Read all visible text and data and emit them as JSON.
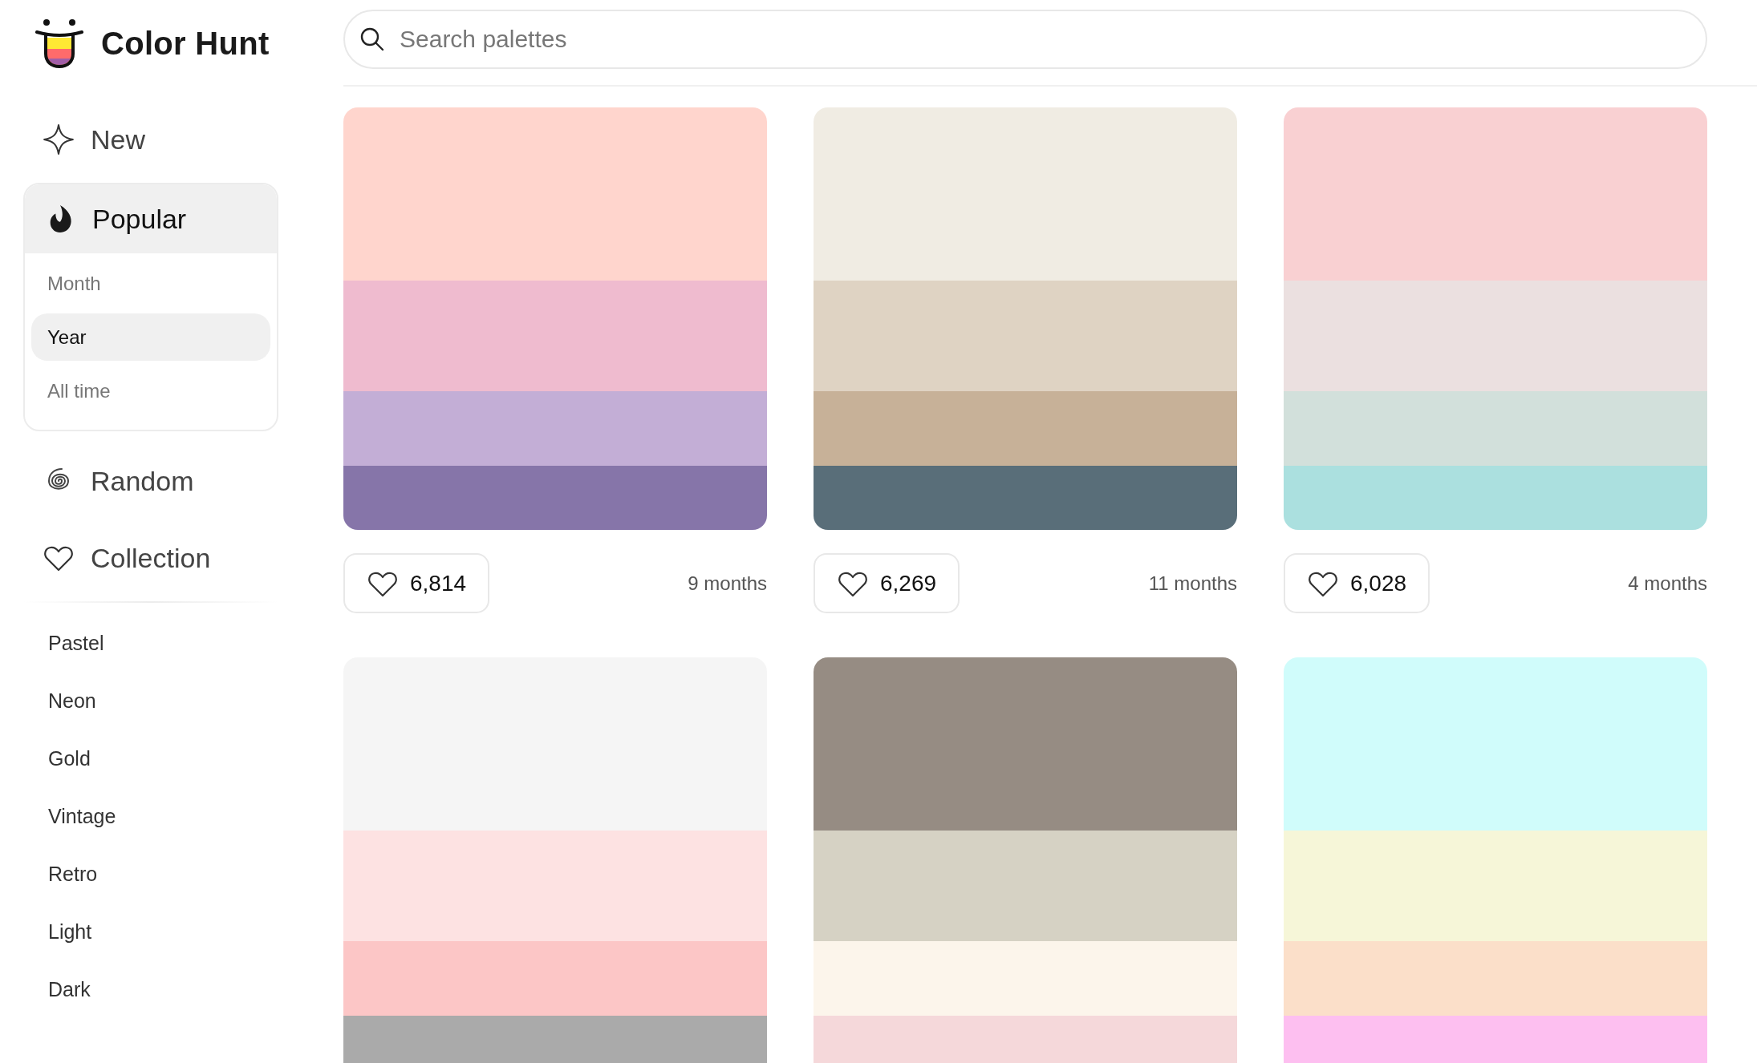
{
  "logo": {
    "text": "Color Hunt"
  },
  "search": {
    "placeholder": "Search palettes"
  },
  "nav": [
    {
      "label": "New",
      "selected": false
    },
    {
      "label": "Popular",
      "selected": true,
      "expanded": true,
      "children": [
        {
          "label": "Month",
          "selected": false
        },
        {
          "label": "Year",
          "selected": true
        },
        {
          "label": "All time",
          "selected": false
        }
      ]
    },
    {
      "label": "Random",
      "selected": false
    },
    {
      "label": "Collection",
      "selected": false
    }
  ],
  "tags": [
    "Pastel",
    "Neon",
    "Gold",
    "Vintage",
    "Retro",
    "Light",
    "Dark"
  ],
  "palettes": [
    {
      "stripes": [
        {
          "color": "#ffd5cd"
        },
        {
          "color": "#efbbcf"
        },
        {
          "color": "#c3aed6"
        },
        {
          "color": "#8675a9"
        }
      ],
      "likes": "6,814",
      "age": "9 months"
    },
    {
      "stripes": [
        {
          "color": "#f0ece3"
        },
        {
          "color": "#dfd3c3"
        },
        {
          "color": "#c7b198"
        },
        {
          "color": "#596e79"
        }
      ],
      "likes": "6,269",
      "age": "11 months"
    },
    {
      "stripes": [
        {
          "color": "#f9d0d2"
        },
        {
          "color": "#ebe0e0"
        },
        {
          "color": "#d2e0db"
        },
        {
          "color": "#abe0df"
        }
      ],
      "likes": "6,028",
      "age": "4 months"
    },
    {
      "stripes": [
        {
          "color": "#f5f5f5"
        },
        {
          "color": "#fde2e2"
        },
        {
          "color": "#fcc6c6"
        },
        {
          "color": "#aaaaaa"
        }
      ]
    },
    {
      "stripes": [
        {
          "color": "#968c83"
        },
        {
          "color": "#d6d2c4"
        },
        {
          "color": "#fcf5eb"
        },
        {
          "color": "#f5d8da"
        }
      ]
    },
    {
      "stripes": [
        {
          "color": "#d0fcfb"
        },
        {
          "color": "#f6f6d8"
        },
        {
          "color": "#fbdfc9"
        },
        {
          "color": "#fdbff0"
        }
      ]
    }
  ]
}
